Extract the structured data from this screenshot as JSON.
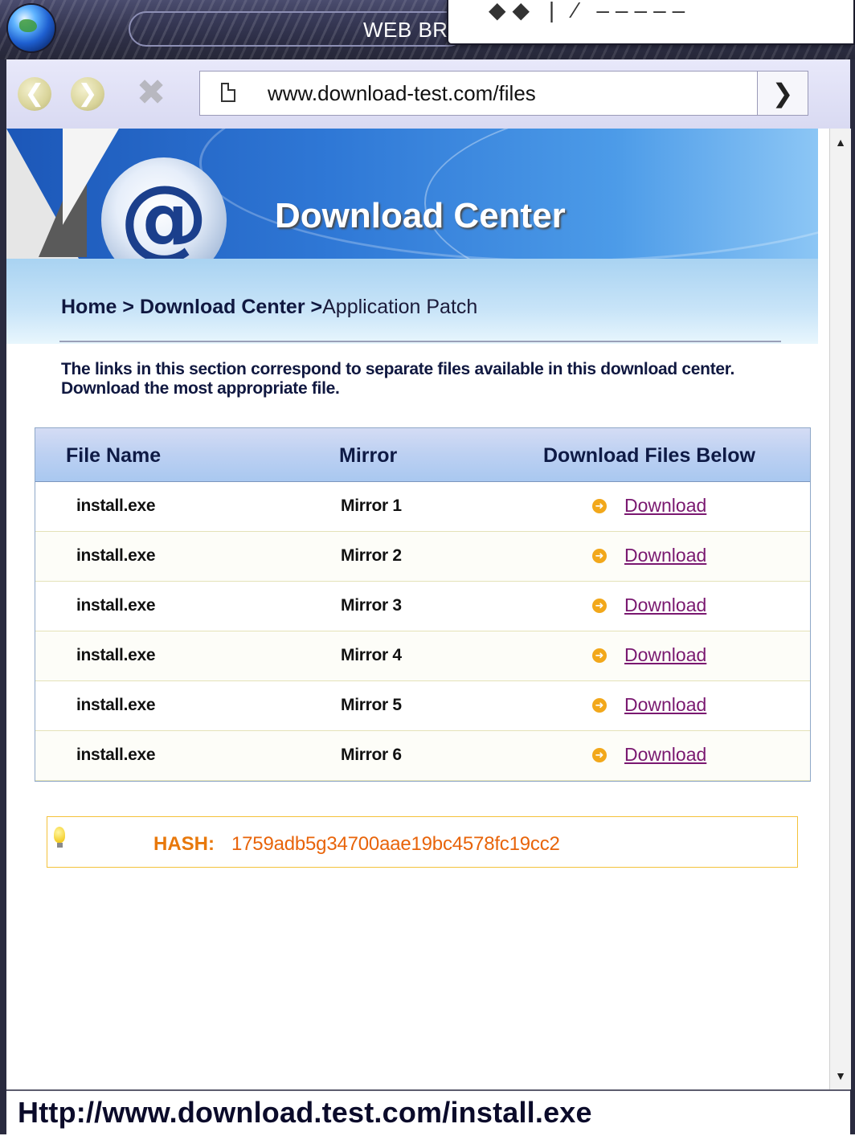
{
  "window": {
    "title": "WEB BR",
    "overlay_glyphs": "◆◆ | ⁄ ‒‒‒‒‒"
  },
  "toolbar": {
    "back_icon": "back-arrow-icon",
    "forward_icon": "forward-arrow-icon",
    "stop_icon": "stop-x-icon",
    "url": "www.download-test.com/files",
    "go_icon": "go-arrow-icon"
  },
  "page": {
    "banner_title": "Download Center",
    "breadcrumb": {
      "home": "Home",
      "sep1": ">",
      "section": "Download Center",
      "sep2": ">",
      "current": "Application Patch"
    },
    "intro": "The links in this section correspond to separate files available in this download center. Download the most appropriate file.",
    "table": {
      "headers": {
        "file_name": "File Name",
        "mirror": "Mirror",
        "download": "Download Files Below"
      },
      "rows": [
        {
          "file": "install.exe",
          "mirror": "Mirror 1",
          "link": "Download"
        },
        {
          "file": "install.exe",
          "mirror": "Mirror 2",
          "link": "Download"
        },
        {
          "file": "install.exe",
          "mirror": "Mirror 3",
          "link": "Download"
        },
        {
          "file": "install.exe",
          "mirror": "Mirror 4",
          "link": "Download"
        },
        {
          "file": "install.exe",
          "mirror": "Mirror 5",
          "link": "Download"
        },
        {
          "file": "install.exe",
          "mirror": "Mirror 6",
          "link": "Download"
        }
      ]
    },
    "hash": {
      "label": "HASH:",
      "value": "1759adb5g34700aae19bc4578fc19cc2"
    }
  },
  "statusbar": {
    "text": "Http://www.download.test.com/install.exe"
  },
  "colors": {
    "link": "#7a1870",
    "hash": "#e8640a",
    "header_bg": "#bcd0f2",
    "banner": "#2f78d6"
  }
}
